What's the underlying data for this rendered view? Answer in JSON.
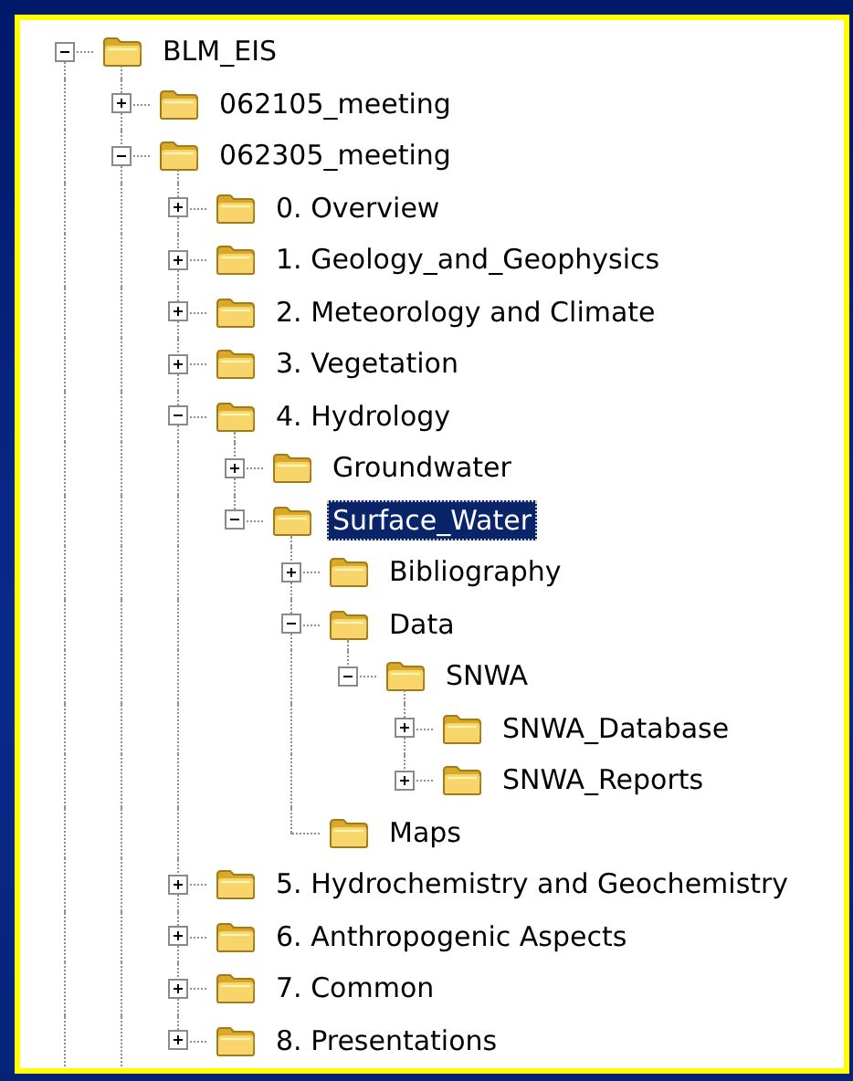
{
  "tree": [
    {
      "label": "BLM_EIS",
      "kind": "expandable",
      "expanded": true,
      "selected": false,
      "continues": true,
      "children": [
        {
          "label": "062105_meeting",
          "kind": "expandable",
          "expanded": false,
          "selected": false
        },
        {
          "label": "062305_meeting",
          "kind": "expandable",
          "expanded": true,
          "selected": false,
          "continues": true,
          "children": [
            {
              "label": "0. Overview",
              "kind": "expandable",
              "expanded": false,
              "selected": false
            },
            {
              "label": "1. Geology_and_Geophysics",
              "kind": "expandable",
              "expanded": false,
              "selected": false
            },
            {
              "label": "2. Meteorology and Climate",
              "kind": "expandable",
              "expanded": false,
              "selected": false
            },
            {
              "label": "3. Vegetation",
              "kind": "expandable",
              "expanded": false,
              "selected": false
            },
            {
              "label": "4. Hydrology",
              "kind": "expandable",
              "expanded": true,
              "selected": false,
              "children": [
                {
                  "label": "Groundwater",
                  "kind": "expandable",
                  "expanded": false,
                  "selected": false
                },
                {
                  "label": "Surface_Water",
                  "kind": "expandable",
                  "expanded": true,
                  "selected": true,
                  "children": [
                    {
                      "label": "Bibliography",
                      "kind": "expandable",
                      "expanded": false,
                      "selected": false
                    },
                    {
                      "label": "Data",
                      "kind": "expandable",
                      "expanded": true,
                      "selected": false,
                      "children": [
                        {
                          "label": "SNWA",
                          "kind": "expandable",
                          "expanded": true,
                          "selected": false,
                          "children": [
                            {
                              "label": "SNWA_Database",
                              "kind": "expandable",
                              "expanded": false,
                              "selected": false
                            },
                            {
                              "label": "SNWA_Reports",
                              "kind": "expandable",
                              "expanded": false,
                              "selected": false
                            }
                          ]
                        }
                      ]
                    },
                    {
                      "label": "Maps",
                      "kind": "leaf",
                      "selected": false
                    }
                  ]
                }
              ]
            },
            {
              "label": "5. Hydrochemistry and Geochemistry",
              "kind": "expandable",
              "expanded": false,
              "selected": false
            },
            {
              "label": "6. Anthropogenic Aspects",
              "kind": "expandable",
              "expanded": false,
              "selected": false
            },
            {
              "label": "7. Common",
              "kind": "expandable",
              "expanded": false,
              "selected": false
            },
            {
              "label": "8. Presentations",
              "kind": "expandable",
              "expanded": false,
              "selected": false
            }
          ]
        }
      ]
    }
  ]
}
